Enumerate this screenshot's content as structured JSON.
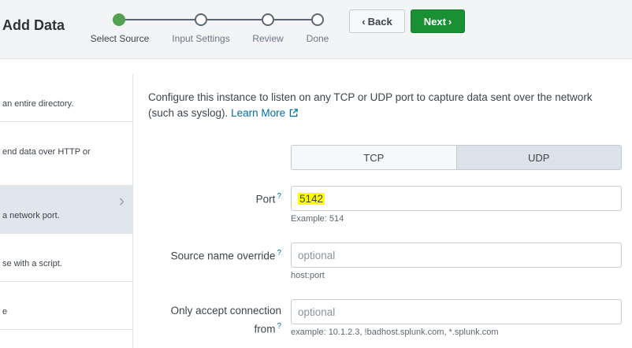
{
  "header": {
    "title": "Add Data",
    "steps": [
      {
        "label": "Select Source",
        "active": true
      },
      {
        "label": "Input Settings",
        "active": false
      },
      {
        "label": "Review",
        "active": false
      },
      {
        "label": "Done",
        "active": false
      }
    ],
    "back_label": "Back",
    "next_label": "Next",
    "colors": {
      "active_step": "#53a051",
      "next_button": "#1a9035"
    }
  },
  "sidebar": {
    "items": [
      {
        "text": "an entire directory."
      },
      {
        "text": "end data over HTTP or"
      },
      {
        "text": "a network port.",
        "selected": true
      },
      {
        "text": "se with a script."
      },
      {
        "text": "e"
      }
    ]
  },
  "main": {
    "description": "Configure this instance to listen on any TCP or UDP port to capture data sent over the network (such as syslog).",
    "learn_more": "Learn More",
    "protocol": {
      "tcp": "TCP",
      "udp": "UDP",
      "selected": "UDP"
    },
    "port": {
      "label": "Port",
      "value": "5142",
      "hint": "Example: 514"
    },
    "source_name": {
      "label": "Source name override",
      "placeholder": "optional",
      "hint": "host:port"
    },
    "accept_from": {
      "label_line1": "Only accept connection",
      "label_line2": "from",
      "placeholder": "optional",
      "hint": "example: 10.1.2.3, !badhost.splunk.com, *.splunk.com"
    },
    "help_mark": "?"
  }
}
